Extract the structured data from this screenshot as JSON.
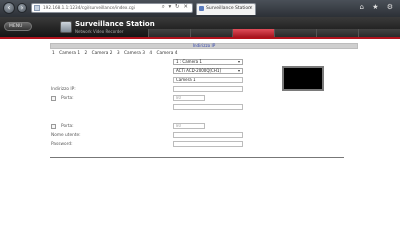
{
  "browser": {
    "address": "192.168.1.1:1234/cgi/surveillance/index.cgi",
    "address_tools": "⌕ ▾ ↻ ✕",
    "tab_title": "Surveillance Station",
    "tab_close": "×",
    "back_icon": "back-arrow-icon",
    "forward_icon": "forward-arrow-icon",
    "toolbar_icons": "⌂ ★ ⚙"
  },
  "app": {
    "menu_button": "MENU",
    "title": "Surveillance Station",
    "subtitle": "Network Video Recorder",
    "active_tab_index": 2,
    "accent_color": "#b0121c"
  },
  "section": {
    "title": "Indirizzo IP",
    "camera_tabs": [
      "1",
      "Camera 1",
      "2",
      "Camera 2",
      "3",
      "Camera 3",
      "4",
      "Camera 4"
    ]
  },
  "form": {
    "camera_select": "1 : Camera 1",
    "model_select": "ACTi ACD-2000Q[CH1]",
    "camera_name": "Camera 1",
    "ip_label": "Indirizzo IP:",
    "ip_value": "",
    "port_label": "Porta:",
    "port_value": "80",
    "extra_field": "",
    "port2_label": "Porta:",
    "port2_value": "80",
    "username_label": "Nome utente:",
    "username_value": "",
    "password_label": "Password:",
    "password_value": ""
  }
}
